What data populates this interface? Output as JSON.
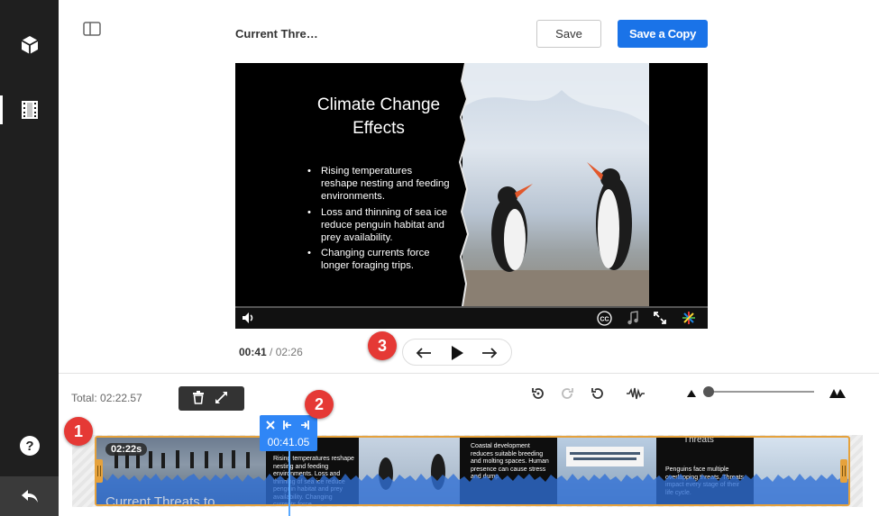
{
  "header": {
    "title": "Current Thre…",
    "save_label": "Save",
    "save_copy_label": "Save a Copy"
  },
  "slide": {
    "title_line1": "Climate Change",
    "title_line2": "Effects",
    "bullets": [
      "Rising temperatures reshape nesting and feeding environments.",
      "Loss and thinning of sea ice reduce penguin habitat and prey availability.",
      "Changing currents force longer foraging trips."
    ]
  },
  "player": {
    "current_time": "00:41",
    "separator": "/",
    "duration": "02:26",
    "cc_label": "CC"
  },
  "markers": [
    "1",
    "2",
    "3"
  ],
  "timeline": {
    "total_label": "Total: 02:22.57",
    "clip_duration": "02:22s",
    "playhead_time": "00:41.05",
    "thumb_bottom_title": "Current Threats to",
    "thumb_texts": {
      "t2": "Rising temperatures reshape nesting and feeding environments. Loss and thinning of sea ice reduce penguin habitat and prey availability. Changing currents force",
      "t5": "Coastal development reduces suitable breeding and molting spaces. Human presence can cause stress and dump",
      "t7_title": "Threats",
      "t7": "Penguins face multiple overlapping threats. Threats impact every stage of their life cycle."
    }
  },
  "colors": {
    "accent": "#1a73e8",
    "marker": "#e53935",
    "clip_border": "#e6a23c",
    "playhead": "#2f86f6",
    "rail": "#1f1f1f"
  }
}
